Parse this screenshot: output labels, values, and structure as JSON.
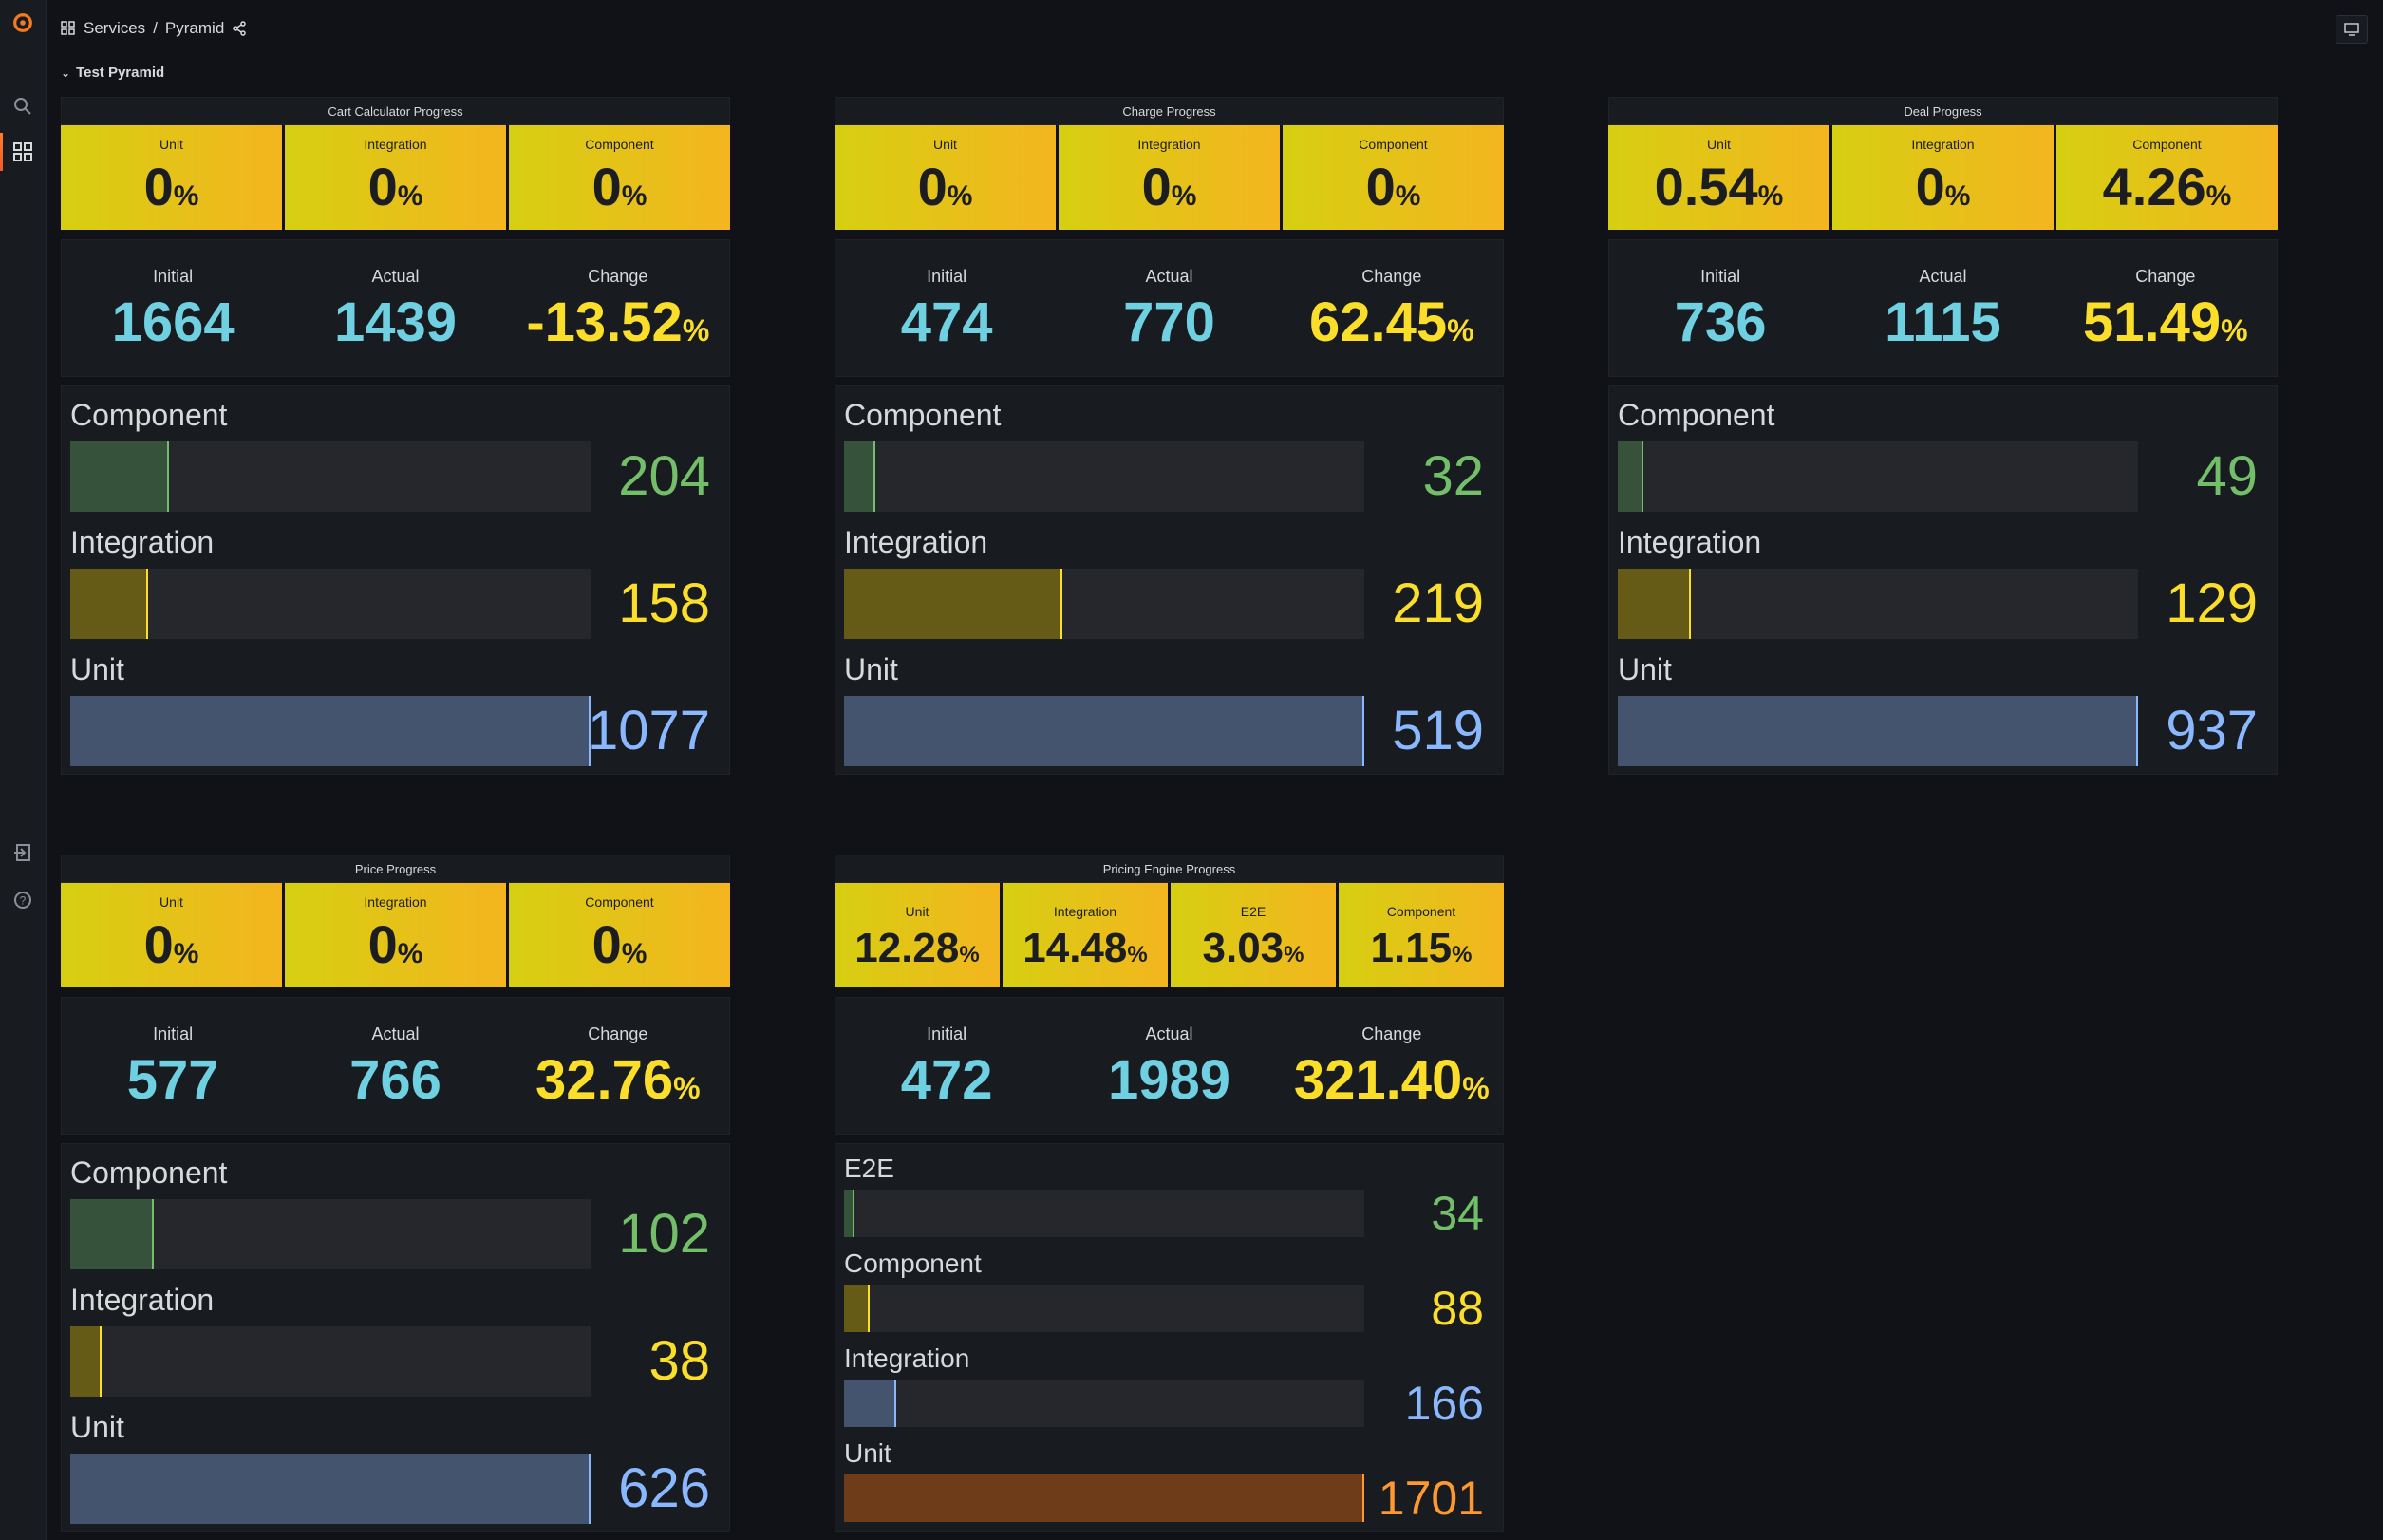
{
  "breadcrumb": {
    "folder": "Services",
    "separator": "/",
    "dashboard": "Pyramid"
  },
  "row": {
    "title": "Test Pyramid"
  },
  "colors": {
    "green": "#73bf69",
    "green_fill": "#37523a",
    "yellow": "#fade2a",
    "yellow_fill": "#665a17",
    "blue": "#8ab8ff",
    "blue_fill": "#45546e",
    "orange": "#ff9830",
    "orange_fill": "#6e3c18"
  },
  "panels": [
    {
      "title": "Cart Calculator Progress",
      "tiles": [
        {
          "label": "Unit",
          "value": "0",
          "unit": "%"
        },
        {
          "label": "Integration",
          "value": "0",
          "unit": "%"
        },
        {
          "label": "Component",
          "value": "0",
          "unit": "%"
        }
      ],
      "stats": {
        "initial_label": "Initial",
        "initial": "1664",
        "actual_label": "Actual",
        "actual": "1439",
        "change_label": "Change",
        "change": "-13.52",
        "change_unit": "%"
      },
      "bars": [
        {
          "label": "Component",
          "value": 204,
          "fraction": 0.19,
          "color": "green"
        },
        {
          "label": "Integration",
          "value": 158,
          "fraction": 0.15,
          "color": "yellow"
        },
        {
          "label": "Unit",
          "value": 1077,
          "fraction": 1.0,
          "color": "blue"
        }
      ]
    },
    {
      "title": "Charge Progress",
      "tiles": [
        {
          "label": "Unit",
          "value": "0",
          "unit": "%"
        },
        {
          "label": "Integration",
          "value": "0",
          "unit": "%"
        },
        {
          "label": "Component",
          "value": "0",
          "unit": "%"
        }
      ],
      "stats": {
        "initial_label": "Initial",
        "initial": "474",
        "actual_label": "Actual",
        "actual": "770",
        "change_label": "Change",
        "change": "62.45",
        "change_unit": "%"
      },
      "bars": [
        {
          "label": "Component",
          "value": 32,
          "fraction": 0.06,
          "color": "green"
        },
        {
          "label": "Integration",
          "value": 219,
          "fraction": 0.42,
          "color": "yellow"
        },
        {
          "label": "Unit",
          "value": 519,
          "fraction": 1.0,
          "color": "blue"
        }
      ]
    },
    {
      "title": "Deal Progress",
      "tiles": [
        {
          "label": "Unit",
          "value": "0.54",
          "unit": "%"
        },
        {
          "label": "Integration",
          "value": "0",
          "unit": "%"
        },
        {
          "label": "Component",
          "value": "4.26",
          "unit": "%"
        }
      ],
      "stats": {
        "initial_label": "Initial",
        "initial": "736",
        "actual_label": "Actual",
        "actual": "1115",
        "change_label": "Change",
        "change": "51.49",
        "change_unit": "%"
      },
      "bars": [
        {
          "label": "Component",
          "value": 49,
          "fraction": 0.05,
          "color": "green"
        },
        {
          "label": "Integration",
          "value": 129,
          "fraction": 0.14,
          "color": "yellow"
        },
        {
          "label": "Unit",
          "value": 937,
          "fraction": 1.0,
          "color": "blue"
        }
      ]
    },
    {
      "title": "Price Progress",
      "tiles": [
        {
          "label": "Unit",
          "value": "0",
          "unit": "%"
        },
        {
          "label": "Integration",
          "value": "0",
          "unit": "%"
        },
        {
          "label": "Component",
          "value": "0",
          "unit": "%"
        }
      ],
      "stats": {
        "initial_label": "Initial",
        "initial": "577",
        "actual_label": "Actual",
        "actual": "766",
        "change_label": "Change",
        "change": "32.76",
        "change_unit": "%"
      },
      "bars": [
        {
          "label": "Component",
          "value": 102,
          "fraction": 0.16,
          "color": "green"
        },
        {
          "label": "Integration",
          "value": 38,
          "fraction": 0.06,
          "color": "yellow"
        },
        {
          "label": "Unit",
          "value": 626,
          "fraction": 1.0,
          "color": "blue"
        }
      ]
    },
    {
      "title": "Pricing Engine Progress",
      "tiles": [
        {
          "label": "Unit",
          "value": "12.28",
          "unit": "%"
        },
        {
          "label": "Integration",
          "value": "14.48",
          "unit": "%"
        },
        {
          "label": "E2E",
          "value": "3.03",
          "unit": "%"
        },
        {
          "label": "Component",
          "value": "1.15",
          "unit": "%"
        }
      ],
      "stats": {
        "initial_label": "Initial",
        "initial": "472",
        "actual_label": "Actual",
        "actual": "1989",
        "change_label": "Change",
        "change": "321.40",
        "change_unit": "%"
      },
      "bars": [
        {
          "label": "E2E",
          "value": 34,
          "fraction": 0.02,
          "color": "green"
        },
        {
          "label": "Component",
          "value": 88,
          "fraction": 0.05,
          "color": "yellow"
        },
        {
          "label": "Integration",
          "value": 166,
          "fraction": 0.1,
          "color": "blue"
        },
        {
          "label": "Unit",
          "value": 1701,
          "fraction": 1.0,
          "color": "orange"
        }
      ]
    }
  ]
}
